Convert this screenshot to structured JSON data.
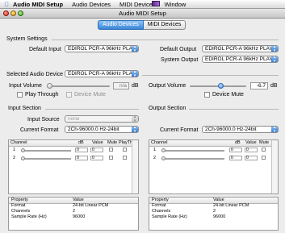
{
  "menubar": {
    "app_name": "Audio MIDI Setup",
    "items": [
      "Audio Devices",
      "MIDI Devices",
      "Window"
    ]
  },
  "window": {
    "title": "Audio MIDI Setup"
  },
  "tabs": [
    {
      "label": "Audio Devices",
      "active": true
    },
    {
      "label": "MIDI Devices",
      "active": false
    }
  ],
  "system_settings": {
    "heading": "System Settings",
    "default_input_label": "Default Input",
    "default_input_value": "EDIROL PCR-A 96kHz PLA",
    "default_output_label": "Default Output",
    "default_output_value": "EDIROL PCR-A 96kHz PLAY",
    "system_output_label": "System Output",
    "system_output_value": "EDIROL PCR-A 96kHz PLAY"
  },
  "selected_device": {
    "label": "Selected Audio Device",
    "value": "EDIROL PCR-A 96kHz PLA"
  },
  "input_volume": {
    "label": "Input Volume",
    "value": "n/a",
    "unit": "dB",
    "level": 0.0
  },
  "output_volume": {
    "label": "Output Volume",
    "value": "-6.7",
    "unit": "dB",
    "level": 0.55
  },
  "play_through": {
    "label": "Play Through",
    "checked": false
  },
  "device_mute_input": {
    "label": "Device Mute",
    "checked": false
  },
  "device_mute_output": {
    "label": "Device Mute",
    "checked": false
  },
  "input_section": {
    "heading": "Input Section",
    "source_label": "Input Source",
    "source_value": "none",
    "format_label": "Current Format",
    "format_value": "2Ch-96000.0 Hz-24bit",
    "channel_headers": [
      "Channel",
      "dB",
      "Value",
      "Mute",
      "PlayThru"
    ],
    "channels": [
      {
        "num": "1",
        "db": "0",
        "value": "0"
      },
      {
        "num": "2",
        "db": "0",
        "value": "0"
      }
    ],
    "prop_headers": [
      "Property",
      "Value"
    ],
    "properties": [
      {
        "property": "Format",
        "value": "24-bit Linear PCM"
      },
      {
        "property": "Channels",
        "value": "2"
      },
      {
        "property": "Sample Rate (Hz)",
        "value": "96000"
      }
    ]
  },
  "output_section": {
    "heading": "Output Section",
    "format_label": "Current Format",
    "format_value": "2Ch-96000.0 Hz-24bit",
    "channel_headers": [
      "Channel",
      "dB",
      "Value",
      "Mute"
    ],
    "channels": [
      {
        "num": "1",
        "db": "0",
        "value": "0"
      },
      {
        "num": "2",
        "db": "0",
        "value": "0"
      }
    ],
    "prop_headers": [
      "Property",
      "Value"
    ],
    "properties": [
      {
        "property": "Format",
        "value": "24-bit Linear PCM"
      },
      {
        "property": "Channels",
        "value": "2"
      },
      {
        "property": "Sample Rate (Hz)",
        "value": "96000"
      }
    ]
  },
  "colors": {
    "accent": "#3a86d8"
  }
}
